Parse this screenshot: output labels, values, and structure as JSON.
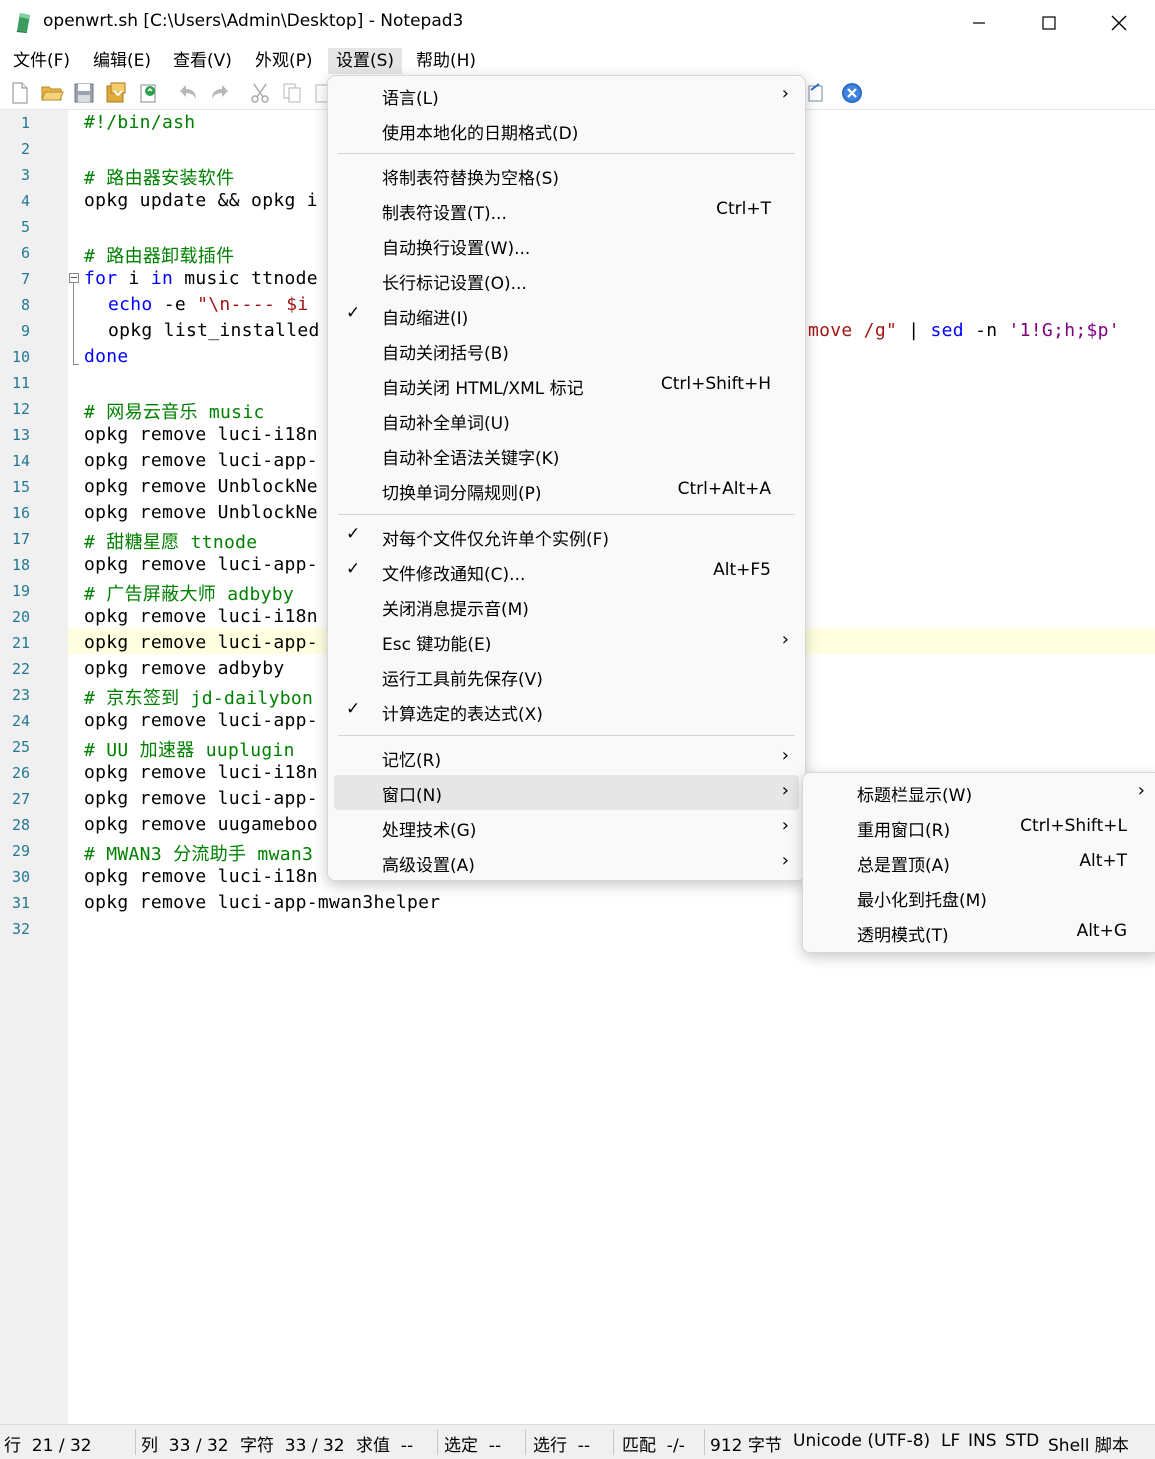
{
  "window": {
    "title": "openwrt.sh [C:\\Users\\Admin\\Desktop] - Notepad3",
    "minimize": "—",
    "maximize": "☐",
    "close": "✕"
  },
  "menubar": {
    "file": "文件(F)",
    "edit": "编辑(E)",
    "view": "查看(V)",
    "appearance": "外观(P)",
    "settings": "设置(S)",
    "help": "帮助(H)"
  },
  "toolbar_icons": [
    "new-file-icon",
    "open-folder-icon",
    "save-icon",
    "save-as-icon",
    "reload-icon",
    "undo-icon",
    "redo-icon",
    "cut-icon",
    "copy-icon",
    "paste-icon",
    "pin-icon",
    "close-x-icon"
  ],
  "editor": {
    "line_numbers": [
      "1",
      "2",
      "3",
      "4",
      "5",
      "6",
      "7",
      "8",
      "9",
      "10",
      "11",
      "12",
      "13",
      "14",
      "15",
      "16",
      "17",
      "18",
      "19",
      "20",
      "21",
      "22",
      "23",
      "24",
      "25",
      "26",
      "27",
      "28",
      "29",
      "30",
      "31",
      "32"
    ],
    "lines": {
      "l1": "#!/bin/ash",
      "l3": "# 路由器安装软件",
      "l4": "opkg update && opkg i",
      "l6": "# 路由器卸载插件",
      "l7_for": "for",
      "l7_mid": " i ",
      "l7_in": "in",
      "l7_rest": " music ttnode",
      "l8_echo": "echo",
      "l8_mid": " -e ",
      "l8_str": "\"\\n---- $i",
      "l9": "opkg list_installed",
      "l9_tail_str": "move /g\"",
      "l9_pipe": " | ",
      "l9_sed": "sed",
      "l9_n": " -n ",
      "l9_q": "'1!G;h;$p'",
      "l10": "done",
      "l12": "# 网易云音乐 music",
      "l13": "opkg remove luci-i18n",
      "l14": "opkg remove luci-app-",
      "l15": "opkg remove UnblockNe",
      "l16": "opkg remove UnblockNe",
      "l17": "# 甜糖星愿 ttnode",
      "l18": "opkg remove luci-app-",
      "l19": "# 广告屏蔽大师 adbyby",
      "l20": "opkg remove luci-i18n",
      "l21": "opkg remove luci-app-",
      "l22": "opkg remove adbyby",
      "l23": "# 京东签到 jd-dailybon",
      "l24": "opkg remove luci-app-",
      "l25": "# UU 加速器 uuplugin",
      "l26": "opkg remove luci-i18n",
      "l27": "opkg remove luci-app-",
      "l28": "opkg remove uugameboo",
      "l29": "# MWAN3 分流助手 mwan3",
      "l30": "opkg remove luci-i18n",
      "l31": "opkg remove luci-app-mwan3helper"
    },
    "current_line": 21
  },
  "settings_menu": {
    "items": [
      {
        "label": "语言(L)",
        "submenu": true
      },
      {
        "label": "使用本地化的日期格式(D)"
      },
      {
        "label": "将制表符替换为空格(S)"
      },
      {
        "label": "制表符设置(T)...",
        "shortcut": "Ctrl+T"
      },
      {
        "label": "自动换行设置(W)..."
      },
      {
        "label": "长行标记设置(O)..."
      },
      {
        "label": "自动缩进(I)",
        "checked": true
      },
      {
        "label": "自动关闭括号(B)"
      },
      {
        "label": "自动关闭 HTML/XML 标记",
        "shortcut": "Ctrl+Shift+H"
      },
      {
        "label": "自动补全单词(U)"
      },
      {
        "label": "自动补全语法关键字(K)"
      },
      {
        "label": "切换单词分隔规则(P)",
        "shortcut": "Ctrl+Alt+A"
      },
      {
        "label": "对每个文件仅允许单个实例(F)",
        "checked": true
      },
      {
        "label": "文件修改通知(C)...",
        "shortcut": "Alt+F5",
        "checked": true
      },
      {
        "label": "关闭消息提示音(M)"
      },
      {
        "label": "Esc 键功能(E)",
        "submenu": true
      },
      {
        "label": "运行工具前先保存(V)"
      },
      {
        "label": "计算选定的表达式(X)",
        "checked": true
      },
      {
        "label": "记忆(R)",
        "submenu": true
      },
      {
        "label": "窗口(N)",
        "submenu": true,
        "highlighted": true
      },
      {
        "label": "处理技术(G)",
        "submenu": true
      },
      {
        "label": "高级设置(A)",
        "submenu": true
      }
    ]
  },
  "window_submenu": {
    "items": [
      {
        "label": "标题栏显示(W)",
        "submenu": true
      },
      {
        "label": "重用窗口(R)",
        "shortcut": "Ctrl+Shift+L"
      },
      {
        "label": "总是置顶(A)",
        "shortcut": "Alt+T"
      },
      {
        "label": "最小化到托盘(M)"
      },
      {
        "label": "透明模式(T)",
        "shortcut": "Alt+G"
      }
    ]
  },
  "glyphs": {
    "check": "✓",
    "arrow": "›"
  },
  "statusbar": {
    "line": "行  21 / 32",
    "col": "列  33 / 32",
    "char": "字符  33 / 32",
    "eval": "求值  --",
    "sel": "选定  --",
    "sel_lines": "选行  --",
    "match": "匹配  -/-",
    "size": "912 字节",
    "encoding": "Unicode (UTF-8)",
    "eol": "LF",
    "ovr": "INS",
    "mode": "STD",
    "lexer": "Shell 脚本"
  }
}
